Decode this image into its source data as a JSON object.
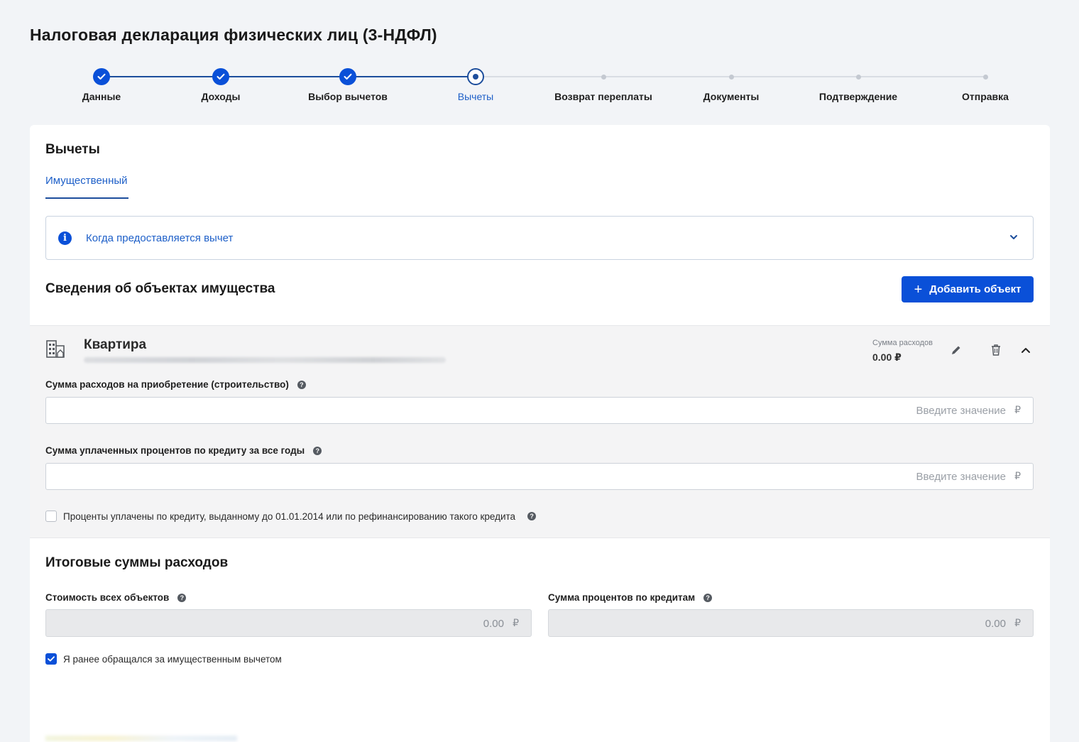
{
  "page": {
    "title": "Налоговая декларация физических лиц (3-НДФЛ)"
  },
  "stepper": {
    "steps": [
      {
        "label": "Данные",
        "state": "done"
      },
      {
        "label": "Доходы",
        "state": "done"
      },
      {
        "label": "Выбор вычетов",
        "state": "done"
      },
      {
        "label": "Вычеты",
        "state": "current"
      },
      {
        "label": "Возврат переплаты",
        "state": "todo"
      },
      {
        "label": "Документы",
        "state": "todo"
      },
      {
        "label": "Подтверждение",
        "state": "todo"
      },
      {
        "label": "Отправка",
        "state": "todo"
      }
    ]
  },
  "deductions": {
    "title": "Вычеты",
    "tab_property": "Имущественный",
    "info_text": "Когда предоставляется вычет"
  },
  "objects": {
    "title": "Сведения об объектах имущества",
    "add_label": "Добавить объект",
    "item": {
      "name": "Квартира",
      "sum_label": "Сумма расходов",
      "sum_value": "0.00 ₽",
      "acquisition_label": "Сумма расходов на приобретение (строительство)",
      "acquisition_placeholder": "Введите значение",
      "interest_label": "Сумма уплаченных процентов по кредиту за все годы",
      "interest_placeholder": "Введите значение",
      "pre2014_label": "Проценты уплачены по кредиту, выданному до 01.01.2014 или по рефинансированию такого кредита",
      "pre2014_checked": false,
      "currency": "₽"
    }
  },
  "totals": {
    "title": "Итоговые суммы расходов",
    "cost_label": "Стоимость всех объектов",
    "cost_value": "0.00",
    "interest_label": "Сумма процентов по кредитам",
    "interest_value": "0.00",
    "currency": "₽",
    "previous_label": "Я ранее обращался за имущественным вычетом",
    "previous_checked": true
  },
  "colors": {
    "accent": "#0a50d8",
    "step_line": "#1d4e9c",
    "link": "#1d5fc8"
  }
}
